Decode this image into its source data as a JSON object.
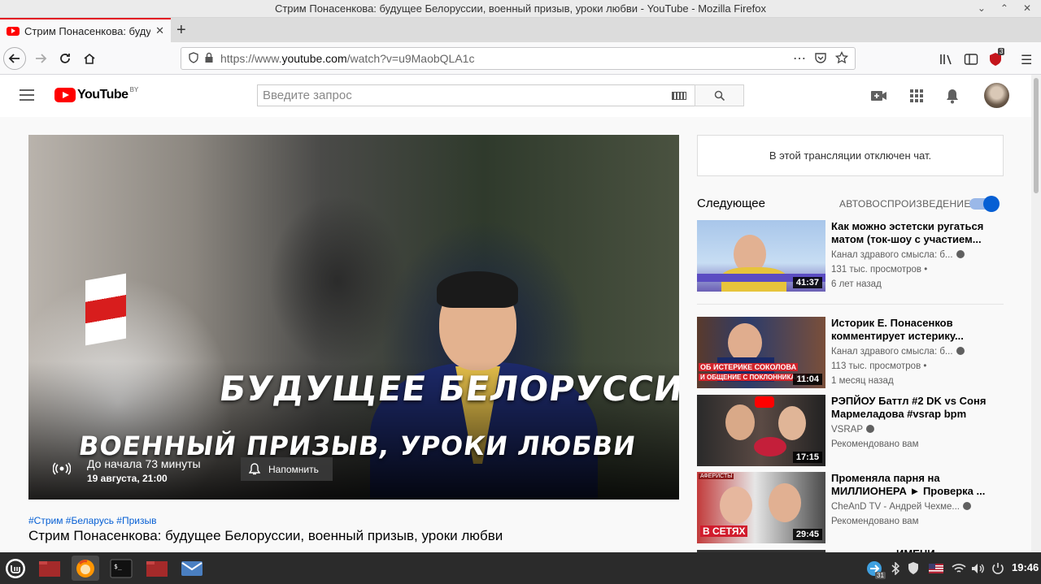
{
  "window": {
    "title": "Стрим Понасенкова: будущее Белоруссии, военный призыв, уроки любви - YouTube - Mozilla Firefox"
  },
  "tab": {
    "title": "Стрим Понасенкова: будущее"
  },
  "navbar": {
    "url_host_prefix": "https://www.",
    "url_host": "youtube.com",
    "url_rest": "/watch?v=u9MaobQLA1c",
    "extension_badge": "3"
  },
  "youtube": {
    "logo_text": "YouTube",
    "region": "BY",
    "search_placeholder": "Введите запрос"
  },
  "player": {
    "thumb_title_line1": "БУДУЩЕЕ БЕЛОРУССИИ,",
    "thumb_title_line2": "ВОЕННЫЙ ПРИЗЫВ, УРОКИ ЛЮБВИ",
    "countdown": "До начала 73 минуты",
    "scheduled": "19 августа, 21:00",
    "remind_label": "Напомнить"
  },
  "video": {
    "hashtags": "#Стрим #Беларусь #Призыв",
    "title": "Стрим Понасенкова: будущее Белоруссии, военный призыв, уроки любви"
  },
  "sidebar": {
    "chat_disabled": "В этой трансляции отключен чат.",
    "up_next": "Следующее",
    "autoplay": "АВТОВОСПРОИЗВЕДЕНИЕ",
    "autoplay_on": true,
    "recommendations": [
      {
        "title": "Как можно эстетски ругаться матом (ток-шоу с участием...",
        "channel": "Канал здравого смысла: б...",
        "views": "131 тыс. просмотров •",
        "age": "6 лет назад",
        "duration": "41:37"
      },
      {
        "title": "Историк Е. Понасенков комментирует истерику...",
        "channel": "Канал здравого смысла: б...",
        "views": "113 тыс. просмотров •",
        "age": "1 месяц назад",
        "duration": "11:04",
        "thumb_caption_1": "ОБ ИСТЕРИКЕ СОКОЛОВА",
        "thumb_caption_2": "И ОБЩЕНИЕ С ПОКЛОННИКАМИ"
      },
      {
        "title": "РЭПЙОУ Баттл #2 DK vs Соня Мармеладова #vsrap bpm",
        "channel": "VSRAP",
        "views": "Рекомендовано вам",
        "age": "",
        "duration": "17:15"
      },
      {
        "title": "Променяла парня на МИЛЛИОНЕРА ► Проверка ...",
        "channel": "CheAnD TV - Андрей Чехме...",
        "views": "Рекомендовано вам",
        "age": "",
        "duration": "29:45",
        "thumb_caption_1": "АФЕРИСТЫ",
        "thumb_caption_2": "В СЕТЯХ"
      }
    ],
    "partial_next_title": "ИМЕНИ"
  },
  "taskbar": {
    "clock": "19:46",
    "update_badge": "31"
  },
  "colors": {
    "yt_red": "#ff0000",
    "link_blue": "#065fd4",
    "firefox_tab_accent": "#e31b23"
  }
}
